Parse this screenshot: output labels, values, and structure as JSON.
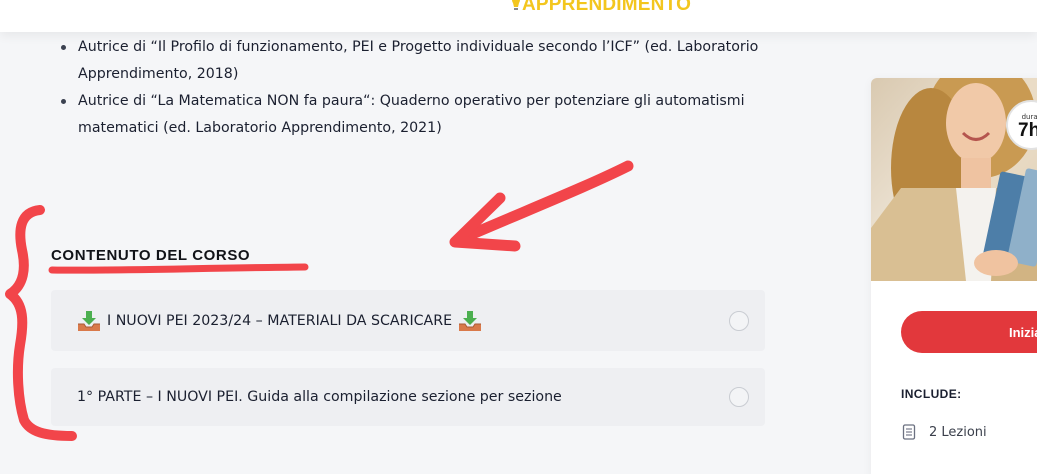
{
  "header": {
    "logo_text": "APPRENDIMENTO",
    "logo_mark": "'"
  },
  "bio": {
    "items": [
      {
        "text": "Autrice di “Il Profilo di funzionamento, PEI e Progetto individuale secondo l’ICF” (ed. Laboratorio Apprendimento, 2018)"
      },
      {
        "text": "Autrice di “La Matematica NON fa paura“: Quaderno operativo per potenziare gli automatismi matematici (ed. Laboratorio Apprendimento, 2021)"
      }
    ]
  },
  "course": {
    "section_title": "CONTENUTO DEL CORSO",
    "lessons": [
      {
        "title": "I NUOVI PEI 2023/24 – MATERIALI DA SCARICARE",
        "icon": "inbox-download-icon",
        "completed": false
      },
      {
        "title": "1° PARTE – I NUOVI PEI. Guida alla compilazione sezione per sezione",
        "completed": false
      }
    ]
  },
  "sidebar": {
    "duration_label": "durat",
    "duration_value": "7h",
    "start_button": "Inizia",
    "include_title": "INCLUDE:",
    "include_items": [
      {
        "icon": "book-icon",
        "text": "2 Lezioni"
      }
    ]
  },
  "colors": {
    "accent_red": "#e2383c",
    "logo_yellow": "#f3c61e",
    "annotation_red": "#f2454a"
  }
}
